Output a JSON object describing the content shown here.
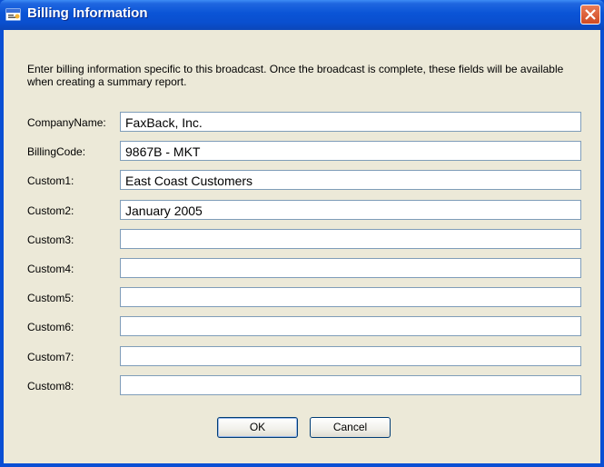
{
  "window": {
    "title": "Billing Information"
  },
  "description": "Enter billing information specific to this broadcast.  Once the broadcast is complete, these fields will be available when creating a summary report.",
  "fields": [
    {
      "label": "CompanyName:",
      "value": "FaxBack, Inc."
    },
    {
      "label": "BillingCode:",
      "value": "9867B - MKT"
    },
    {
      "label": "Custom1:",
      "value": "East Coast Customers"
    },
    {
      "label": "Custom2:",
      "value": "January 2005"
    },
    {
      "label": "Custom3:",
      "value": ""
    },
    {
      "label": "Custom4:",
      "value": ""
    },
    {
      "label": "Custom5:",
      "value": ""
    },
    {
      "label": "Custom6:",
      "value": ""
    },
    {
      "label": "Custom7:",
      "value": ""
    },
    {
      "label": "Custom8:",
      "value": ""
    }
  ],
  "buttons": {
    "ok_label": "OK",
    "cancel_label": "Cancel"
  },
  "colors": {
    "titlebar": "#0a4fd4",
    "client_bg": "#ece9d8",
    "close_button": "#d04a22",
    "field_border": "#7f9db9"
  },
  "icons": {
    "title_icon": "app-window-icon",
    "close_icon": "close-x-icon"
  }
}
